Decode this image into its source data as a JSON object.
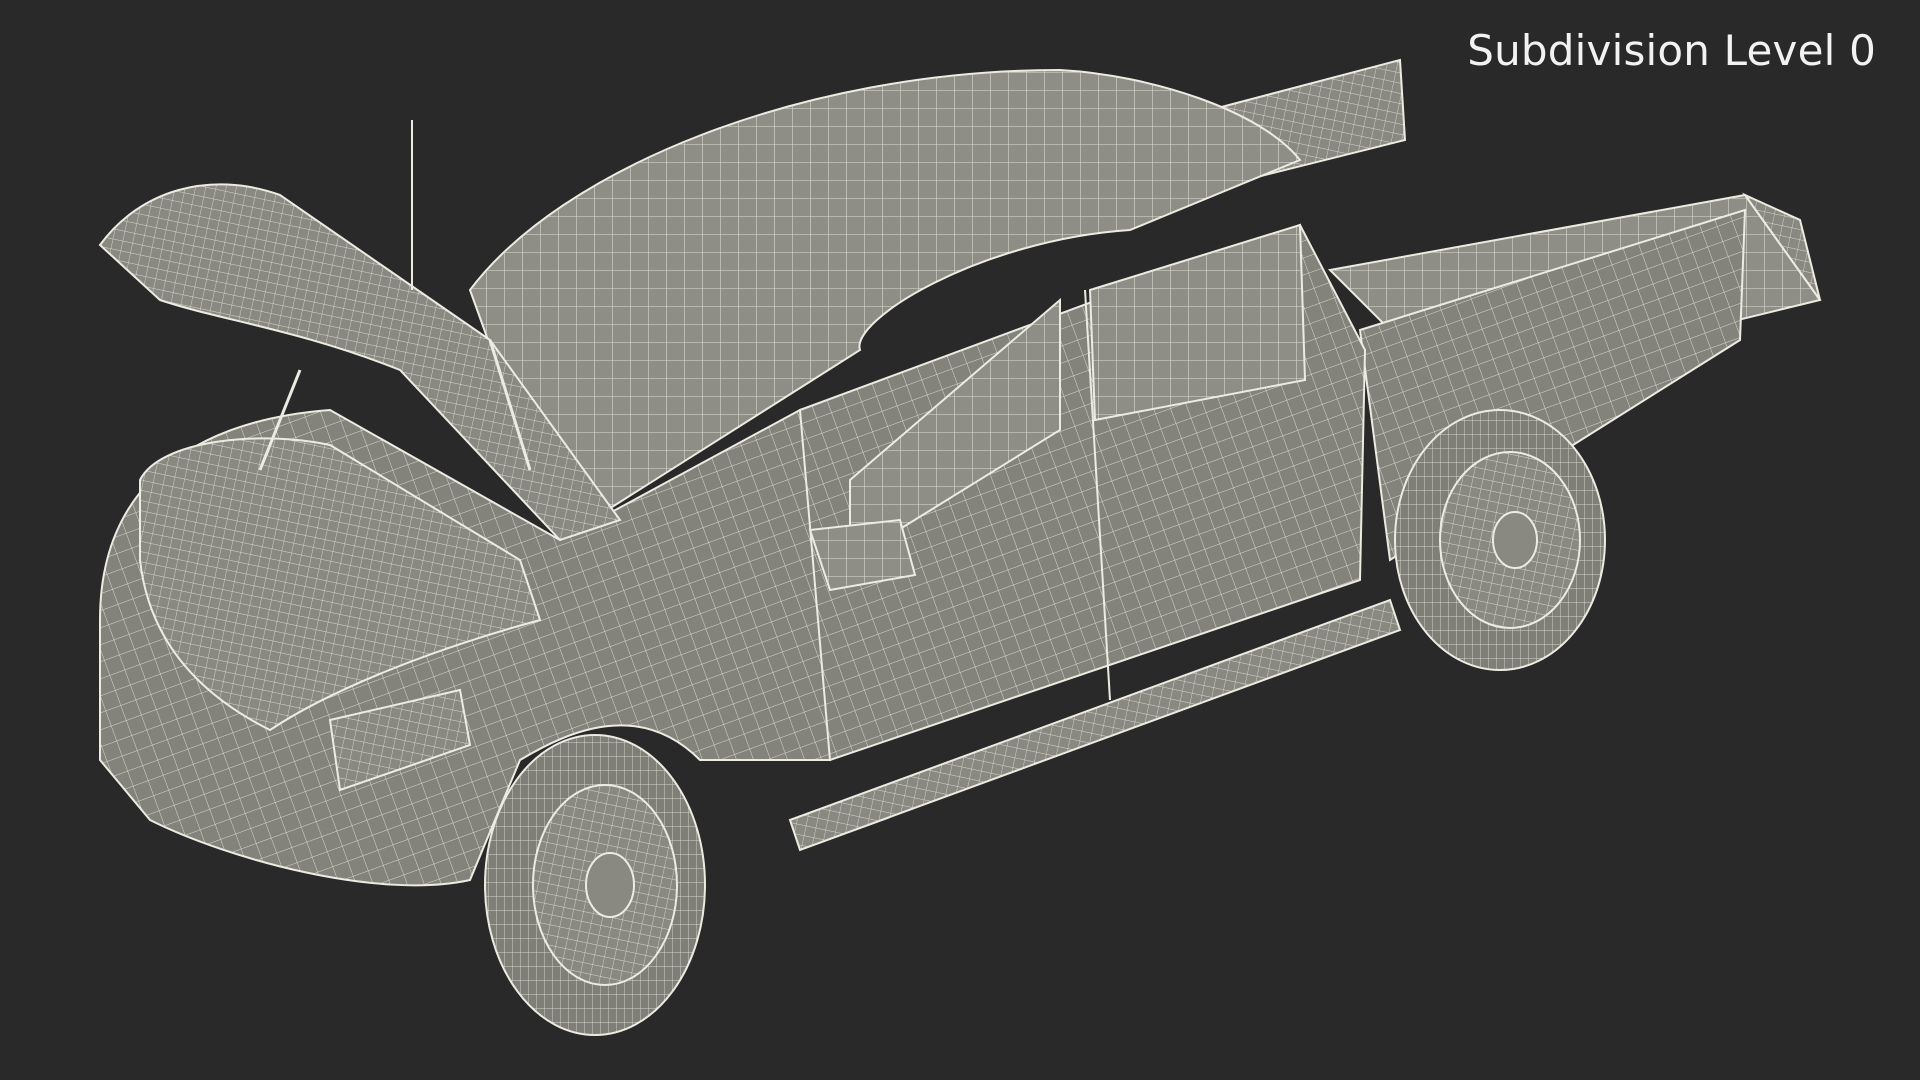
{
  "caption": {
    "text": "Subdivision Level 0"
  },
  "scene": {
    "background_color": "#292929",
    "mesh_fill_color": "#8f8e86",
    "wire_color": "#ecebe2",
    "subject_icon": "wireframe-pickup-truck"
  }
}
